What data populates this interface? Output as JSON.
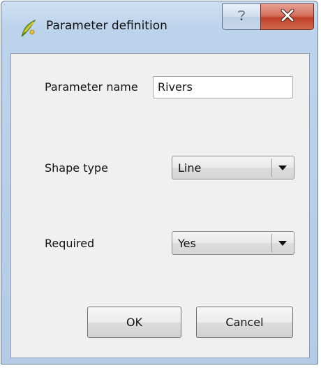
{
  "window": {
    "title": "Parameter definition",
    "help_icon": "question-mark-icon",
    "close_icon": "close-x-icon",
    "app_icon": "qgis-icon"
  },
  "form": {
    "parameter_name_label": "Parameter name",
    "parameter_name_value": "Rivers",
    "shape_type_label": "Shape type",
    "shape_type_value": "Line",
    "required_label": "Required",
    "required_value": "Yes"
  },
  "buttons": {
    "ok_label": "OK",
    "cancel_label": "Cancel"
  },
  "colors": {
    "close_button": "#c7503a",
    "frame": "#b9cfe7",
    "dialog_background": "#f0f0f0"
  }
}
